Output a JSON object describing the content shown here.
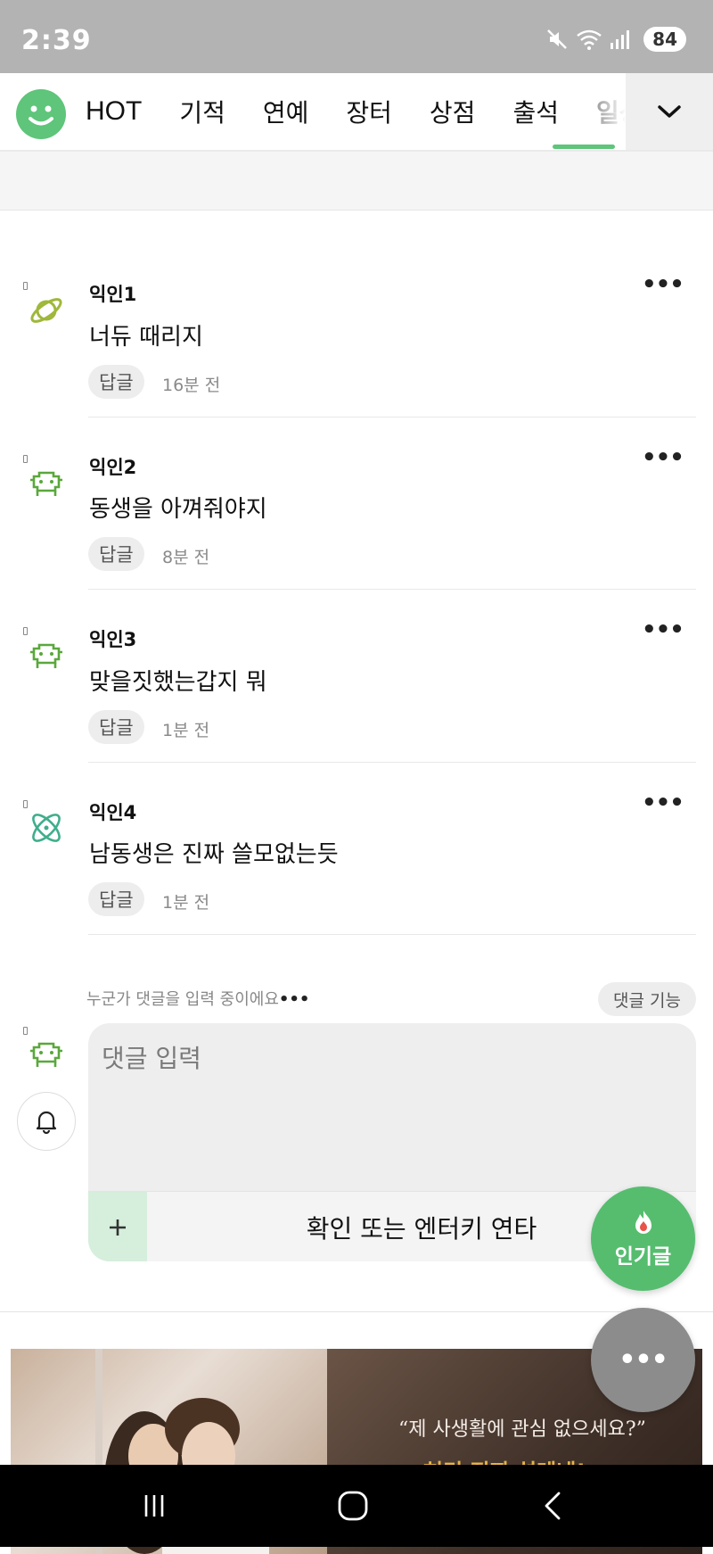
{
  "status_bar": {
    "time": "2:39",
    "battery": "84"
  },
  "nav": {
    "tabs": [
      {
        "label": "HOT"
      },
      {
        "label": "기적"
      },
      {
        "label": "연예"
      },
      {
        "label": "장터"
      },
      {
        "label": "상점"
      },
      {
        "label": "출석"
      },
      {
        "label": "일상"
      }
    ],
    "active_tab": "일상"
  },
  "comments": [
    {
      "author": "익인1",
      "text": "너듀 때리지",
      "reply_label": "답글",
      "time": "16분 전",
      "avatar_icon": "planet-icon"
    },
    {
      "author": "익인2",
      "text": "동생을 아껴줘야지",
      "reply_label": "답글",
      "time": "8분 전",
      "avatar_icon": "space-invader-icon"
    },
    {
      "author": "익인3",
      "text": "맞을짓했는갑지 뭐",
      "reply_label": "답글",
      "time": "1분 전",
      "avatar_icon": "space-invader-icon"
    },
    {
      "author": "익인4",
      "text": "남동생은 진짜 쓸모없는듯",
      "reply_label": "답글",
      "time": "1분 전",
      "avatar_icon": "atom-icon"
    }
  ],
  "composer": {
    "typing_notice": "누군가 댓글을 입력 중이에요",
    "feature_button": "댓글 기능",
    "placeholder": "댓글 입력",
    "submit_label": "확인 또는 엔터키 연타"
  },
  "fab": {
    "popular_label": "인기글"
  },
  "ad": {
    "quote": "“제 사생활에 관심 없으세요?”",
    "title": "허리 진짜 설레네!"
  },
  "colors": {
    "accent": "#5ec57a",
    "fab_popular": "#56bd6f",
    "fab_more": "#8c8c8c",
    "status_bar": "#b3b3b3"
  }
}
